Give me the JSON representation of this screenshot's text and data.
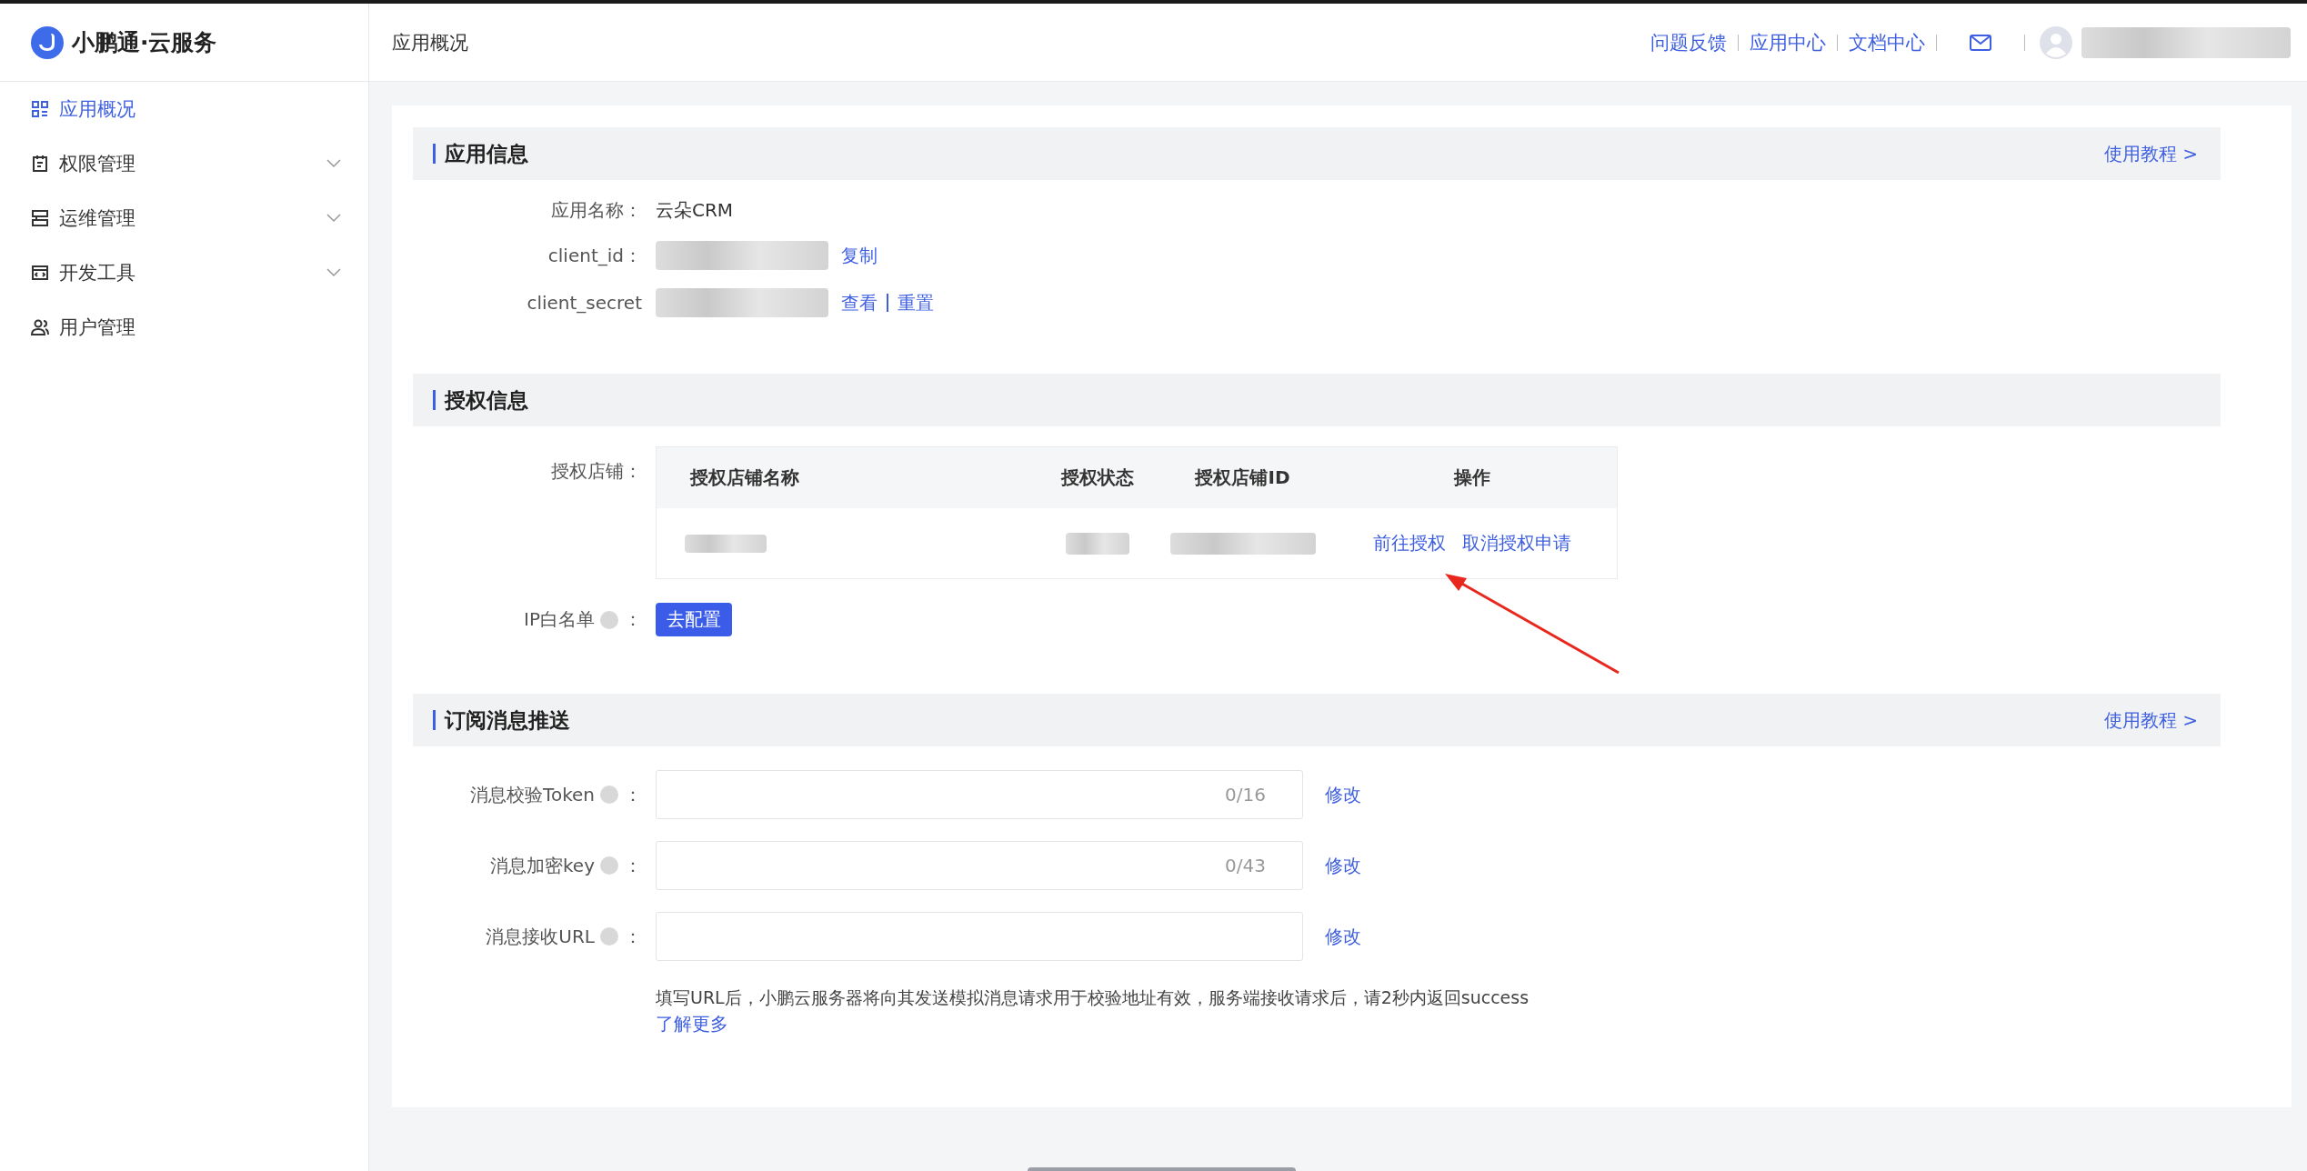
{
  "brand": {
    "name": "小鹏通·云服务"
  },
  "sidebar": {
    "items": [
      {
        "label": "应用概况",
        "kind": "grid",
        "selected": true,
        "expandable": false
      },
      {
        "label": "权限管理",
        "kind": "clipboard",
        "selected": false,
        "expandable": true
      },
      {
        "label": "运维管理",
        "kind": "server",
        "selected": false,
        "expandable": true
      },
      {
        "label": "开发工具",
        "kind": "code",
        "selected": false,
        "expandable": true
      },
      {
        "label": "用户管理",
        "kind": "users",
        "selected": false,
        "expandable": false
      }
    ]
  },
  "header": {
    "title": "应用概况",
    "links": [
      "问题反馈",
      "应用中心",
      "文档中心"
    ]
  },
  "app_info": {
    "title": "应用信息",
    "tutorial_link": "使用教程 >",
    "fields": [
      {
        "label": "应用名称：",
        "kind": "text",
        "value": "云朵CRM"
      },
      {
        "label": "client_id：",
        "kind": "redacted",
        "actions": [
          "复制"
        ]
      },
      {
        "label": "client_secret",
        "kind": "redacted",
        "actions": [
          "查看",
          "重置"
        ]
      }
    ]
  },
  "auth_info": {
    "title": "授权信息",
    "shops_label": "授权店铺：",
    "table": {
      "columns": [
        "授权店铺名称",
        "授权状态",
        "授权店铺ID",
        "操作"
      ],
      "rows": [
        {
          "actions": [
            "前往授权",
            "取消授权申请"
          ]
        }
      ]
    },
    "ip_whitelist": {
      "label": "IP白名单",
      "suffix": "：",
      "button": "去配置"
    }
  },
  "subscription": {
    "title": "订阅消息推送",
    "tutorial_link": "使用教程 >",
    "fields": [
      {
        "label": "消息校验Token",
        "suffix": "：",
        "counter": "0/16",
        "action": "修改"
      },
      {
        "label": "消息加密key",
        "suffix": "：",
        "counter": "0/43",
        "action": "修改"
      },
      {
        "label": "消息接收URL",
        "suffix": "：",
        "action": "修改"
      }
    ],
    "help": "填写URL后，小鹏云服务器将向其发送模拟消息请求用于校验地址有效，服务端接收请求后，请2秒内返回success",
    "learn_more": "了解更多"
  }
}
